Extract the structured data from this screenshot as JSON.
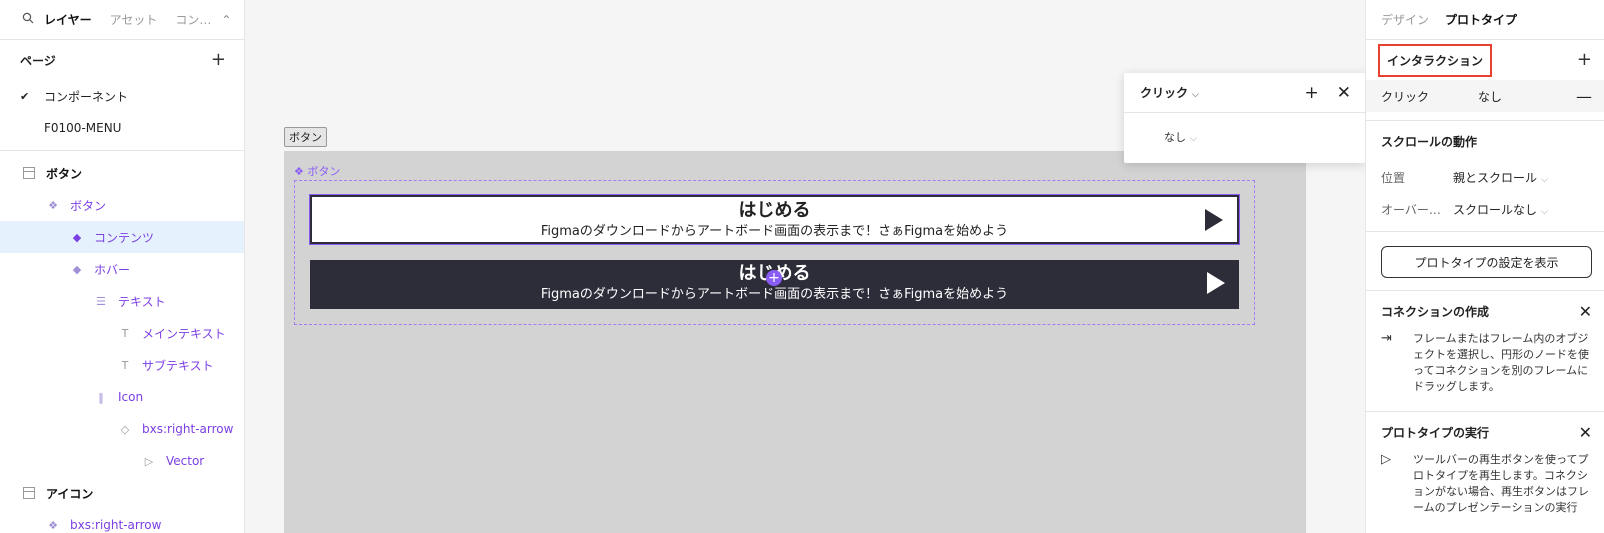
{
  "left_panel": {
    "tabs": [
      "レイヤー",
      "アセット",
      "コン…"
    ],
    "pages_title": "ページ",
    "pages": [
      {
        "label": "コンポーネント",
        "current": true
      },
      {
        "label": "F0100-MENU",
        "current": false
      }
    ],
    "layers": [
      {
        "label": "ボタン",
        "kind": "frame",
        "indent": 0
      },
      {
        "label": "ボタン",
        "kind": "component-set",
        "indent": 1
      },
      {
        "label": "コンテンツ",
        "kind": "component",
        "indent": 2,
        "selected": true
      },
      {
        "label": "ホバー",
        "kind": "component",
        "indent": 2
      },
      {
        "label": "テキスト",
        "kind": "auto-layout",
        "indent": 3
      },
      {
        "label": "メインテキスト",
        "kind": "text",
        "indent": 4
      },
      {
        "label": "サブテキスト",
        "kind": "text",
        "indent": 4
      },
      {
        "label": "Icon",
        "kind": "auto-layout-h",
        "indent": 3
      },
      {
        "label": "bxs:right-arrow",
        "kind": "instance",
        "indent": 4
      },
      {
        "label": "Vector",
        "kind": "vector",
        "indent": 5
      },
      {
        "label": "アイコン",
        "kind": "frame",
        "indent": 0
      },
      {
        "label": "bxs:right-arrow",
        "kind": "component-set",
        "indent": 1
      }
    ]
  },
  "canvas": {
    "frame_label": "ボタン",
    "component_label": "ボタン",
    "buttons": [
      {
        "main": "はじめる",
        "sub": "Figmaのダウンロードからアートボード画面の表示まで！さぁFigmaを始めよう",
        "variant": "light"
      },
      {
        "main": "はじめる",
        "sub": "Figmaのダウンロードからアートボード画面の表示まで！さぁFigmaを始めよう",
        "variant": "dark"
      }
    ],
    "popover": {
      "trigger": "クリック",
      "action": "なし"
    }
  },
  "right_panel": {
    "tabs": [
      "デザイン",
      "プロトタイプ"
    ],
    "interaction_title": "インタラクション",
    "interaction": {
      "trigger": "クリック",
      "action": "なし"
    },
    "scroll_title": "スクロールの動作",
    "position_label": "位置",
    "position_value": "親とスクロール",
    "overflow_label": "オーバー…",
    "overflow_value": "スクロールなし",
    "settings_button": "プロトタイプの設定を表示",
    "connection_title": "コネクションの作成",
    "connection_text": "フレームまたはフレーム内のオブジェクトを選択し、円形のノードを使ってコネクションを別のフレームにドラッグします。",
    "run_title": "プロトタイプの実行",
    "run_text": "ツールバーの再生ボタンを使ってプロトタイプを再生します。コネクションがない場合、再生ボタンはフレームのプレゼンテーションの実行"
  },
  "colors": {
    "accent": "#8a5cf6",
    "highlight": "#e8412f",
    "button_dark": "#2d2d3a",
    "selection": "#e5f2fd"
  }
}
